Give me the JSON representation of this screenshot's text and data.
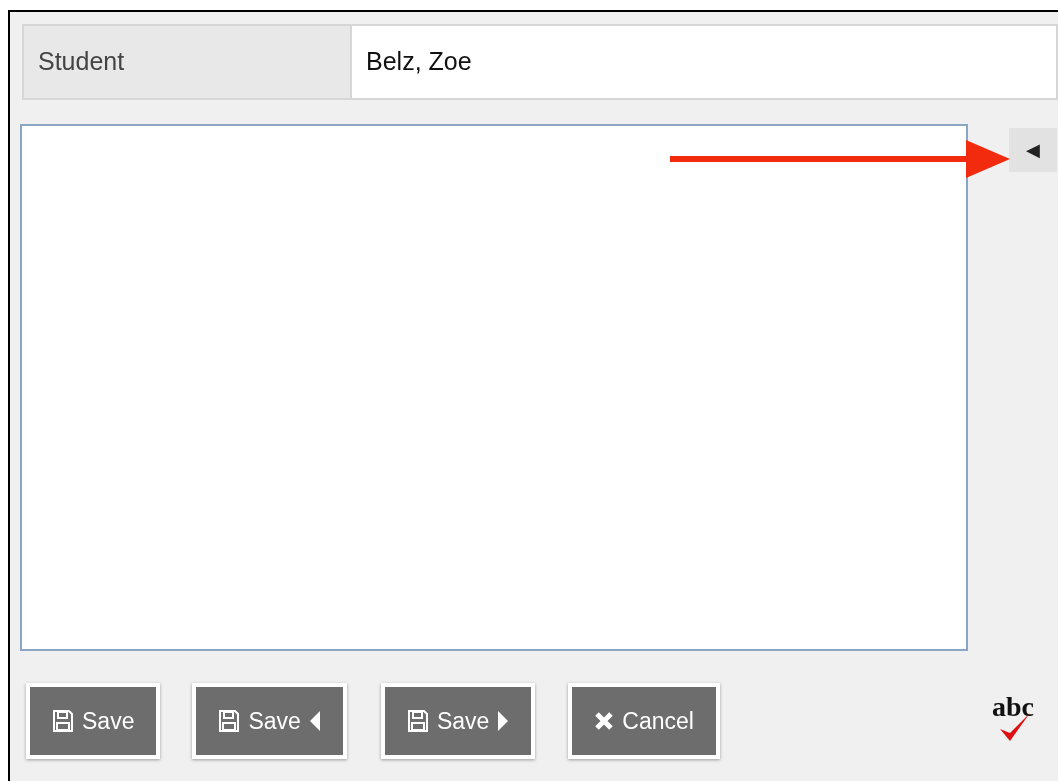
{
  "student": {
    "label": "Student",
    "value": "Belz, Zoe"
  },
  "side_toggle": "◀",
  "buttons": [
    {
      "label": "Save",
      "kind": "save"
    },
    {
      "label": "Save",
      "kind": "save-previous"
    },
    {
      "label": "Save",
      "kind": "save-next"
    },
    {
      "label": "Cancel",
      "kind": "cancel"
    }
  ],
  "spellcheck": "abc"
}
